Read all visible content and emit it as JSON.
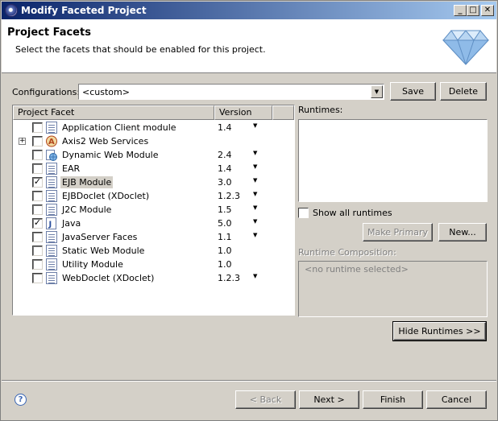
{
  "window": {
    "title": "Modify Faceted Project",
    "min_glyph": "_",
    "max_glyph": "□",
    "close_glyph": "✕"
  },
  "header": {
    "title": "Project Facets",
    "description": "Select the facets that should be enabled for this project."
  },
  "config": {
    "label": "Configurations:",
    "value": "<custom>",
    "arrow": "▼",
    "save": "Save",
    "delete": "Delete"
  },
  "table": {
    "col_facet": "Project Facet",
    "col_version": "Version",
    "rows": [
      {
        "name": "Application Client module",
        "version": "1.4",
        "checked": false,
        "dropdown": true,
        "icon": "document-icon"
      },
      {
        "name": "Axis2 Web Services",
        "version": "",
        "checked": false,
        "dropdown": false,
        "icon": "axis2-icon",
        "expandable": true
      },
      {
        "name": "Dynamic Web Module",
        "version": "2.4",
        "checked": false,
        "dropdown": true,
        "icon": "web-module-icon"
      },
      {
        "name": "EAR",
        "version": "1.4",
        "checked": false,
        "dropdown": true,
        "icon": "document-icon"
      },
      {
        "name": "EJB Module",
        "version": "3.0",
        "checked": true,
        "dropdown": true,
        "icon": "document-icon",
        "selected": true
      },
      {
        "name": "EJBDoclet (XDoclet)",
        "version": "1.2.3",
        "checked": false,
        "dropdown": true,
        "icon": "document-icon"
      },
      {
        "name": "J2C Module",
        "version": "1.5",
        "checked": false,
        "dropdown": true,
        "icon": "document-icon"
      },
      {
        "name": "Java",
        "version": "5.0",
        "checked": true,
        "dropdown": true,
        "icon": "java-icon"
      },
      {
        "name": "JavaServer Faces",
        "version": "1.1",
        "checked": false,
        "dropdown": true,
        "icon": "document-icon"
      },
      {
        "name": "Static Web Module",
        "version": "1.0",
        "checked": false,
        "dropdown": false,
        "icon": "document-icon"
      },
      {
        "name": "Utility Module",
        "version": "1.0",
        "checked": false,
        "dropdown": false,
        "icon": "document-icon"
      },
      {
        "name": "WebDoclet (XDoclet)",
        "version": "1.2.3",
        "checked": false,
        "dropdown": true,
        "icon": "document-icon"
      }
    ],
    "check_glyph": "✓",
    "drop_glyph": "▼",
    "expand_glyph": "+"
  },
  "runtimes": {
    "label": "Runtimes:",
    "show_all": "Show all runtimes",
    "make_primary": "Make Primary",
    "new": "New...",
    "composition_label": "Runtime Composition:",
    "composition_value": "<no runtime selected>",
    "hide": "Hide Runtimes >>"
  },
  "footer": {
    "help": "?",
    "back": "< Back",
    "next": "Next >",
    "finish": "Finish",
    "cancel": "Cancel"
  }
}
